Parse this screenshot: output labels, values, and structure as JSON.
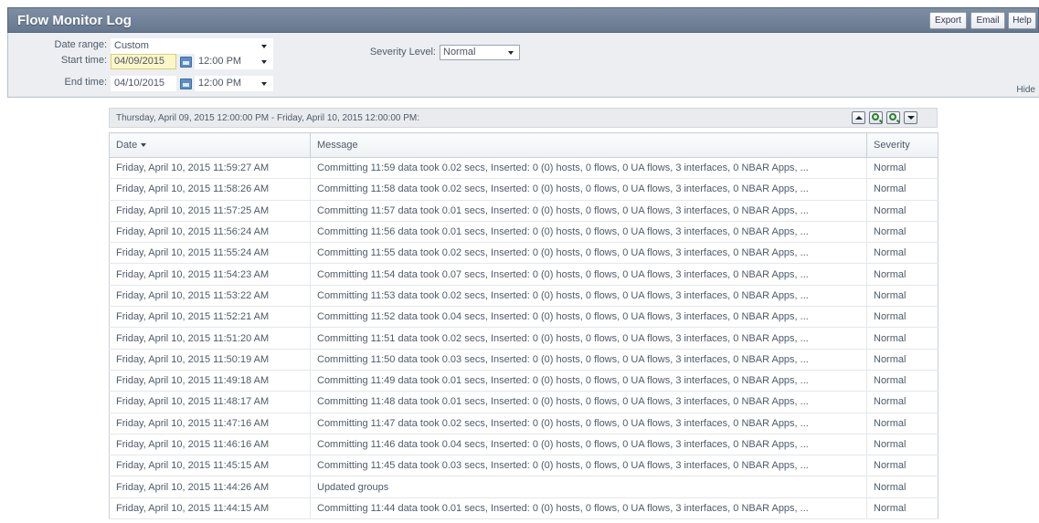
{
  "app": {
    "title": "Flow Monitor Log",
    "buttons": {
      "export": "Export",
      "email": "Email",
      "help": "Help"
    }
  },
  "filters": {
    "date_range_label": "Date range:",
    "date_range_value": "Custom",
    "start_time_label": "Start time:",
    "start_date": "04/09/2015",
    "start_time": "12:00 PM",
    "end_time_label": "End time:",
    "end_date": "04/10/2015",
    "end_time": "12:00 PM",
    "severity_label": "Severity Level:",
    "severity_value": "Normal",
    "hide_label": "Hide"
  },
  "range": {
    "text": "Thursday, April 09, 2015 12:00:00 PM - Friday, April 10, 2015 12:00:00 PM:"
  },
  "table": {
    "columns": [
      "Date",
      "Message",
      "Severity"
    ],
    "rows": [
      {
        "date": "Friday, April 10, 2015 11:59:27 AM",
        "message": "Committing 11:59 data took 0.02 secs, Inserted: 0 (0) hosts, 0 flows, 0 UA flows, 3 interfaces, 0 NBAR Apps, ...",
        "severity": "Normal"
      },
      {
        "date": "Friday, April 10, 2015 11:58:26 AM",
        "message": "Committing 11:58 data took 0.02 secs, Inserted: 0 (0) hosts, 0 flows, 0 UA flows, 3 interfaces, 0 NBAR Apps, ...",
        "severity": "Normal"
      },
      {
        "date": "Friday, April 10, 2015 11:57:25 AM",
        "message": "Committing 11:57 data took 0.01 secs, Inserted: 0 (0) hosts, 0 flows, 0 UA flows, 3 interfaces, 0 NBAR Apps, ...",
        "severity": "Normal"
      },
      {
        "date": "Friday, April 10, 2015 11:56:24 AM",
        "message": "Committing 11:56 data took 0.01 secs, Inserted: 0 (0) hosts, 0 flows, 0 UA flows, 3 interfaces, 0 NBAR Apps, ...",
        "severity": "Normal"
      },
      {
        "date": "Friday, April 10, 2015 11:55:24 AM",
        "message": "Committing 11:55 data took 0.02 secs, Inserted: 0 (0) hosts, 0 flows, 0 UA flows, 3 interfaces, 0 NBAR Apps, ...",
        "severity": "Normal"
      },
      {
        "date": "Friday, April 10, 2015 11:54:23 AM",
        "message": "Committing 11:54 data took 0.07 secs, Inserted: 0 (0) hosts, 0 flows, 0 UA flows, 3 interfaces, 0 NBAR Apps, ...",
        "severity": "Normal"
      },
      {
        "date": "Friday, April 10, 2015 11:53:22 AM",
        "message": "Committing 11:53 data took 0.02 secs, Inserted: 0 (0) hosts, 0 flows, 0 UA flows, 3 interfaces, 0 NBAR Apps, ...",
        "severity": "Normal"
      },
      {
        "date": "Friday, April 10, 2015 11:52:21 AM",
        "message": "Committing 11:52 data took 0.04 secs, Inserted: 0 (0) hosts, 0 flows, 0 UA flows, 3 interfaces, 0 NBAR Apps, ...",
        "severity": "Normal"
      },
      {
        "date": "Friday, April 10, 2015 11:51:20 AM",
        "message": "Committing 11:51 data took 0.02 secs, Inserted: 0 (0) hosts, 0 flows, 0 UA flows, 3 interfaces, 0 NBAR Apps, ...",
        "severity": "Normal"
      },
      {
        "date": "Friday, April 10, 2015 11:50:19 AM",
        "message": "Committing 11:50 data took 0.03 secs, Inserted: 0 (0) hosts, 0 flows, 0 UA flows, 3 interfaces, 0 NBAR Apps, ...",
        "severity": "Normal"
      },
      {
        "date": "Friday, April 10, 2015 11:49:18 AM",
        "message": "Committing 11:49 data took 0.01 secs, Inserted: 0 (0) hosts, 0 flows, 0 UA flows, 3 interfaces, 0 NBAR Apps, ...",
        "severity": "Normal"
      },
      {
        "date": "Friday, April 10, 2015 11:48:17 AM",
        "message": "Committing 11:48 data took 0.01 secs, Inserted: 0 (0) hosts, 0 flows, 0 UA flows, 3 interfaces, 0 NBAR Apps, ...",
        "severity": "Normal"
      },
      {
        "date": "Friday, April 10, 2015 11:47:16 AM",
        "message": "Committing 11:47 data took 0.02 secs, Inserted: 0 (0) hosts, 0 flows, 0 UA flows, 3 interfaces, 0 NBAR Apps, ...",
        "severity": "Normal"
      },
      {
        "date": "Friday, April 10, 2015 11:46:16 AM",
        "message": "Committing 11:46 data took 0.04 secs, Inserted: 0 (0) hosts, 0 flows, 0 UA flows, 3 interfaces, 0 NBAR Apps, ...",
        "severity": "Normal"
      },
      {
        "date": "Friday, April 10, 2015 11:45:15 AM",
        "message": "Committing 11:45 data took 0.03 secs, Inserted: 0 (0) hosts, 0 flows, 0 UA flows, 3 interfaces, 0 NBAR Apps, ...",
        "severity": "Normal"
      },
      {
        "date": "Friday, April 10, 2015 11:44:26 AM",
        "message": "Updated groups",
        "severity": "Normal"
      },
      {
        "date": "Friday, April 10, 2015 11:44:15 AM",
        "message": "Committing 11:44 data took 0.01 secs, Inserted: 0 (0) hosts, 0 flows, 0 UA flows, 3 interfaces, 0 NBAR Apps, ...",
        "severity": "Normal"
      }
    ]
  }
}
